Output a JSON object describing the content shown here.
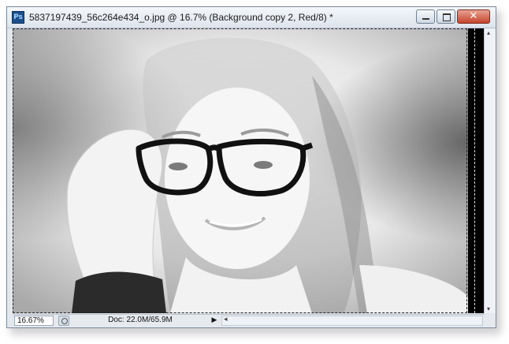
{
  "window": {
    "app_icon_label": "Ps",
    "title": "5837197439_56c264e434_o.jpg @ 16.7% (Background copy 2, Red/8) *",
    "buttons": {
      "minimize_icon": "minimize-icon",
      "maximize_icon": "maximize-icon",
      "close_icon": "close-icon",
      "close_glyph": "✕"
    }
  },
  "canvas": {
    "image_description": "desaturated high-key portrait of a smiling woman adjusting black-framed glasses",
    "selection": "marching-ants"
  },
  "statusbar": {
    "zoom": "16.67%",
    "doc_info": "Doc: 22.0M/65.9M",
    "menu_arrow": "▶",
    "scroll_left_arrow": "◂"
  },
  "vscroll": {
    "up_arrow": "▴",
    "down_arrow": "▾"
  },
  "colors": {
    "title_bar_top": "#f4f7fb",
    "close_button": "#c4452b",
    "ps_icon_bg": "#1a4f8a"
  }
}
